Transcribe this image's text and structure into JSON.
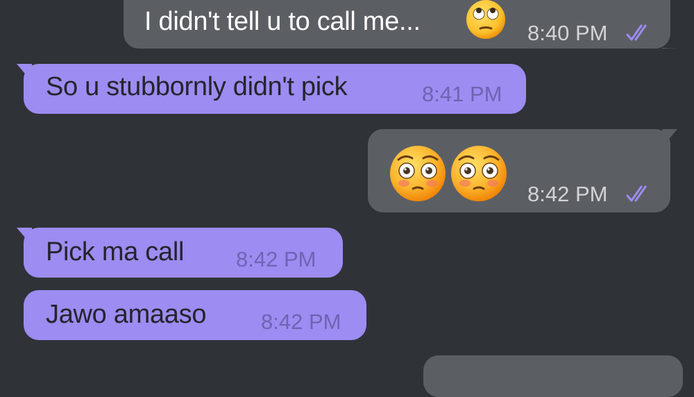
{
  "colors": {
    "background": "#2f3237",
    "outgoing_bubble": "#5b5f64",
    "incoming_bubble": "#9d8cf1",
    "read_ticks": "#9d8cf1"
  },
  "messages": [
    {
      "direction": "outgoing",
      "text": "I didn't tell u to call me...",
      "emoji": "face-with-rolling-eyes",
      "time": "8:40 PM",
      "status": "read"
    },
    {
      "direction": "incoming",
      "text": "So u stubbornly didn't pick",
      "time": "8:41 PM"
    },
    {
      "direction": "outgoing",
      "emoji": [
        "flushed-face",
        "flushed-face"
      ],
      "time": "8:42 PM",
      "status": "read"
    },
    {
      "direction": "incoming",
      "text": "Pick ma call",
      "time": "8:42 PM"
    },
    {
      "direction": "incoming",
      "text": "Jawo amaaso",
      "time": "8:42 PM"
    }
  ]
}
